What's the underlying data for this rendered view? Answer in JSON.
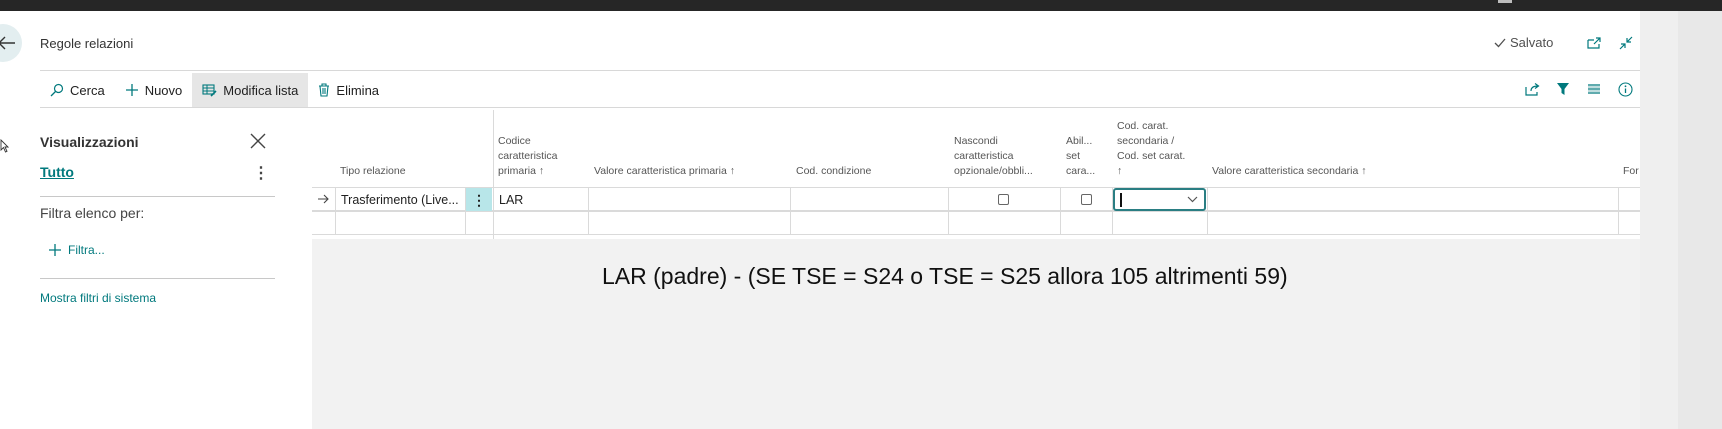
{
  "header": {
    "title": "Regole relazioni",
    "saved_label": "Salvato"
  },
  "toolbar": {
    "search_label": "Cerca",
    "new_label": "Nuovo",
    "edit_list_label": "Modifica lista",
    "delete_label": "Elimina"
  },
  "panel": {
    "title": "Visualizzazioni",
    "all_label": "Tutto",
    "filter_by_label": "Filtra elenco per:",
    "add_filter_label": "Filtra...",
    "system_filters_label": "Mostra filtri di sistema"
  },
  "grid": {
    "columns": {
      "tipo_relazione": "Tipo relazione",
      "codice_car_1": "Codice",
      "codice_car_2": "caratteristica",
      "codice_car_3": "primaria ↑",
      "valore_primaria": "Valore caratteristica primaria ↑",
      "cod_condizione": "Cod. condizione",
      "nascondi_1": "Nascondi",
      "nascondi_2": "caratteristica",
      "nascondi_3": "opzionale/obbli...",
      "abil_1": "Abil...",
      "abil_2": "set",
      "abil_3": "cara...",
      "cod_sec_1": "Cod. carat.",
      "cod_sec_2": "secondaria /",
      "cod_sec_3": "Cod. set carat.",
      "cod_sec_4": "↑",
      "valore_secondaria": "Valore caratteristica secondaria ↑",
      "for_trunc": "For"
    },
    "rows": [
      {
        "tipo": "Trasferimento (Live...",
        "codice": "LAR"
      }
    ]
  },
  "annotation": "LAR (padre) - (SE TSE = S24 o TSE = S25 allora 105 altrimenti 59)",
  "colors": {
    "accent": "#00797d",
    "selected_cell": "#b8e6e9",
    "focus_border": "#2a7e83"
  },
  "icons": [
    "back-arrow-icon",
    "check-icon",
    "open-new-icon",
    "collapse-icon",
    "search-icon",
    "plus-icon",
    "edit-list-icon",
    "trash-icon",
    "share-icon",
    "filter-icon",
    "list-icon",
    "info-icon",
    "close-icon",
    "more-vertical-icon",
    "row-arrow-icon",
    "chevron-down-icon"
  ]
}
